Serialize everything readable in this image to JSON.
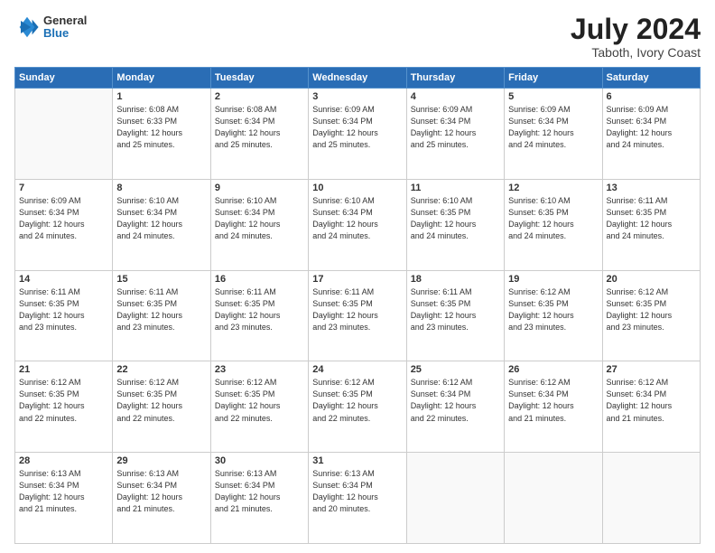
{
  "header": {
    "logo": {
      "general": "General",
      "blue": "Blue"
    },
    "title": "July 2024",
    "location": "Taboth, Ivory Coast"
  },
  "days_of_week": [
    "Sunday",
    "Monday",
    "Tuesday",
    "Wednesday",
    "Thursday",
    "Friday",
    "Saturday"
  ],
  "weeks": [
    [
      {
        "day": "",
        "info": ""
      },
      {
        "day": "1",
        "info": "Sunrise: 6:08 AM\nSunset: 6:33 PM\nDaylight: 12 hours\nand 25 minutes."
      },
      {
        "day": "2",
        "info": "Sunrise: 6:08 AM\nSunset: 6:34 PM\nDaylight: 12 hours\nand 25 minutes."
      },
      {
        "day": "3",
        "info": "Sunrise: 6:09 AM\nSunset: 6:34 PM\nDaylight: 12 hours\nand 25 minutes."
      },
      {
        "day": "4",
        "info": "Sunrise: 6:09 AM\nSunset: 6:34 PM\nDaylight: 12 hours\nand 25 minutes."
      },
      {
        "day": "5",
        "info": "Sunrise: 6:09 AM\nSunset: 6:34 PM\nDaylight: 12 hours\nand 24 minutes."
      },
      {
        "day": "6",
        "info": "Sunrise: 6:09 AM\nSunset: 6:34 PM\nDaylight: 12 hours\nand 24 minutes."
      }
    ],
    [
      {
        "day": "7",
        "info": "Sunrise: 6:09 AM\nSunset: 6:34 PM\nDaylight: 12 hours\nand 24 minutes."
      },
      {
        "day": "8",
        "info": "Sunrise: 6:10 AM\nSunset: 6:34 PM\nDaylight: 12 hours\nand 24 minutes."
      },
      {
        "day": "9",
        "info": "Sunrise: 6:10 AM\nSunset: 6:34 PM\nDaylight: 12 hours\nand 24 minutes."
      },
      {
        "day": "10",
        "info": "Sunrise: 6:10 AM\nSunset: 6:34 PM\nDaylight: 12 hours\nand 24 minutes."
      },
      {
        "day": "11",
        "info": "Sunrise: 6:10 AM\nSunset: 6:35 PM\nDaylight: 12 hours\nand 24 minutes."
      },
      {
        "day": "12",
        "info": "Sunrise: 6:10 AM\nSunset: 6:35 PM\nDaylight: 12 hours\nand 24 minutes."
      },
      {
        "day": "13",
        "info": "Sunrise: 6:11 AM\nSunset: 6:35 PM\nDaylight: 12 hours\nand 24 minutes."
      }
    ],
    [
      {
        "day": "14",
        "info": "Sunrise: 6:11 AM\nSunset: 6:35 PM\nDaylight: 12 hours\nand 23 minutes."
      },
      {
        "day": "15",
        "info": "Sunrise: 6:11 AM\nSunset: 6:35 PM\nDaylight: 12 hours\nand 23 minutes."
      },
      {
        "day": "16",
        "info": "Sunrise: 6:11 AM\nSunset: 6:35 PM\nDaylight: 12 hours\nand 23 minutes."
      },
      {
        "day": "17",
        "info": "Sunrise: 6:11 AM\nSunset: 6:35 PM\nDaylight: 12 hours\nand 23 minutes."
      },
      {
        "day": "18",
        "info": "Sunrise: 6:11 AM\nSunset: 6:35 PM\nDaylight: 12 hours\nand 23 minutes."
      },
      {
        "day": "19",
        "info": "Sunrise: 6:12 AM\nSunset: 6:35 PM\nDaylight: 12 hours\nand 23 minutes."
      },
      {
        "day": "20",
        "info": "Sunrise: 6:12 AM\nSunset: 6:35 PM\nDaylight: 12 hours\nand 23 minutes."
      }
    ],
    [
      {
        "day": "21",
        "info": "Sunrise: 6:12 AM\nSunset: 6:35 PM\nDaylight: 12 hours\nand 22 minutes."
      },
      {
        "day": "22",
        "info": "Sunrise: 6:12 AM\nSunset: 6:35 PM\nDaylight: 12 hours\nand 22 minutes."
      },
      {
        "day": "23",
        "info": "Sunrise: 6:12 AM\nSunset: 6:35 PM\nDaylight: 12 hours\nand 22 minutes."
      },
      {
        "day": "24",
        "info": "Sunrise: 6:12 AM\nSunset: 6:35 PM\nDaylight: 12 hours\nand 22 minutes."
      },
      {
        "day": "25",
        "info": "Sunrise: 6:12 AM\nSunset: 6:34 PM\nDaylight: 12 hours\nand 22 minutes."
      },
      {
        "day": "26",
        "info": "Sunrise: 6:12 AM\nSunset: 6:34 PM\nDaylight: 12 hours\nand 21 minutes."
      },
      {
        "day": "27",
        "info": "Sunrise: 6:12 AM\nSunset: 6:34 PM\nDaylight: 12 hours\nand 21 minutes."
      }
    ],
    [
      {
        "day": "28",
        "info": "Sunrise: 6:13 AM\nSunset: 6:34 PM\nDaylight: 12 hours\nand 21 minutes."
      },
      {
        "day": "29",
        "info": "Sunrise: 6:13 AM\nSunset: 6:34 PM\nDaylight: 12 hours\nand 21 minutes."
      },
      {
        "day": "30",
        "info": "Sunrise: 6:13 AM\nSunset: 6:34 PM\nDaylight: 12 hours\nand 21 minutes."
      },
      {
        "day": "31",
        "info": "Sunrise: 6:13 AM\nSunset: 6:34 PM\nDaylight: 12 hours\nand 20 minutes."
      },
      {
        "day": "",
        "info": ""
      },
      {
        "day": "",
        "info": ""
      },
      {
        "day": "",
        "info": ""
      }
    ]
  ]
}
